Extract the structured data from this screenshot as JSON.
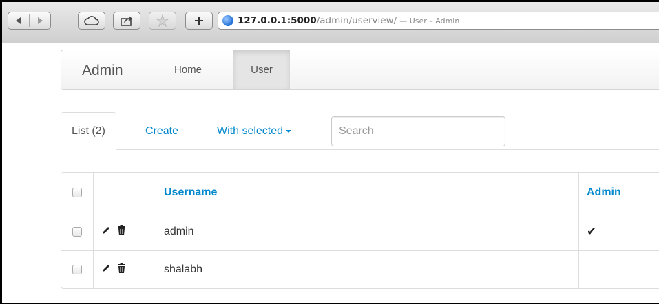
{
  "browser": {
    "url_host": "127.0.0.1:5000",
    "url_path": "/admin/userview/",
    "page_title_suffix": "— User – Admin",
    "icons": [
      "back-icon",
      "forward-icon",
      "cloud-icon",
      "share-icon",
      "star-icon",
      "plus-icon",
      "globe-icon"
    ]
  },
  "navbar": {
    "brand": "Admin",
    "items": [
      {
        "label": "Home",
        "active": false
      },
      {
        "label": "User",
        "active": true
      }
    ]
  },
  "tabs": {
    "list_label": "List (2)",
    "create_label": "Create",
    "with_selected_label": "With selected"
  },
  "search": {
    "placeholder": "Search",
    "value": ""
  },
  "table": {
    "columns": [
      "Username",
      "Admin"
    ],
    "rows": [
      {
        "username": "admin",
        "admin": "✔"
      },
      {
        "username": "shalabh",
        "admin": ""
      }
    ]
  },
  "colors": {
    "link": "#0088cc",
    "text": "#333333"
  }
}
